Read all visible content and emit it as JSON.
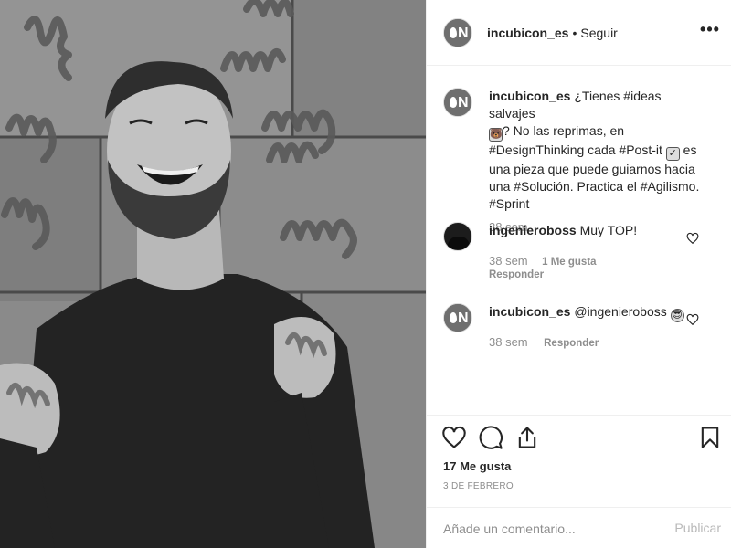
{
  "post": {
    "author": "incubicon_es",
    "separator": "•",
    "follow_label": "Seguir",
    "more_icon": "more-options-icon",
    "avatar_text": "N"
  },
  "caption": {
    "username": "incubicon_es",
    "line1": "¿Tienes #ideas salvajes",
    "emoji1": "🐻",
    "line2_rest": "? No las reprimas, en",
    "line3": "#DesignThinking cada #Post-it",
    "emoji2": "✓",
    "line3_rest": " es",
    "line4": "una pieza que puede guiarnos hacia",
    "line5": "una #Solución. Practica el #Agilismo.",
    "line6": "#Sprint",
    "time": "38 sem"
  },
  "comments": [
    {
      "username": "ingenieroboss",
      "text": "Muy TOP!",
      "time": "38 sem",
      "likes": "1 Me gusta",
      "reply": "Responder"
    },
    {
      "username": "incubicon_es",
      "text": "@ingenieroboss",
      "emoji": "😎",
      "time": "38 sem",
      "reply": "Responder"
    }
  ],
  "actions": {
    "likes_count": "17 Me gusta",
    "date": "3 DE FEBRERO"
  },
  "add_comment": {
    "placeholder": "Añade un comentario...",
    "publish_label": "Publicar"
  }
}
